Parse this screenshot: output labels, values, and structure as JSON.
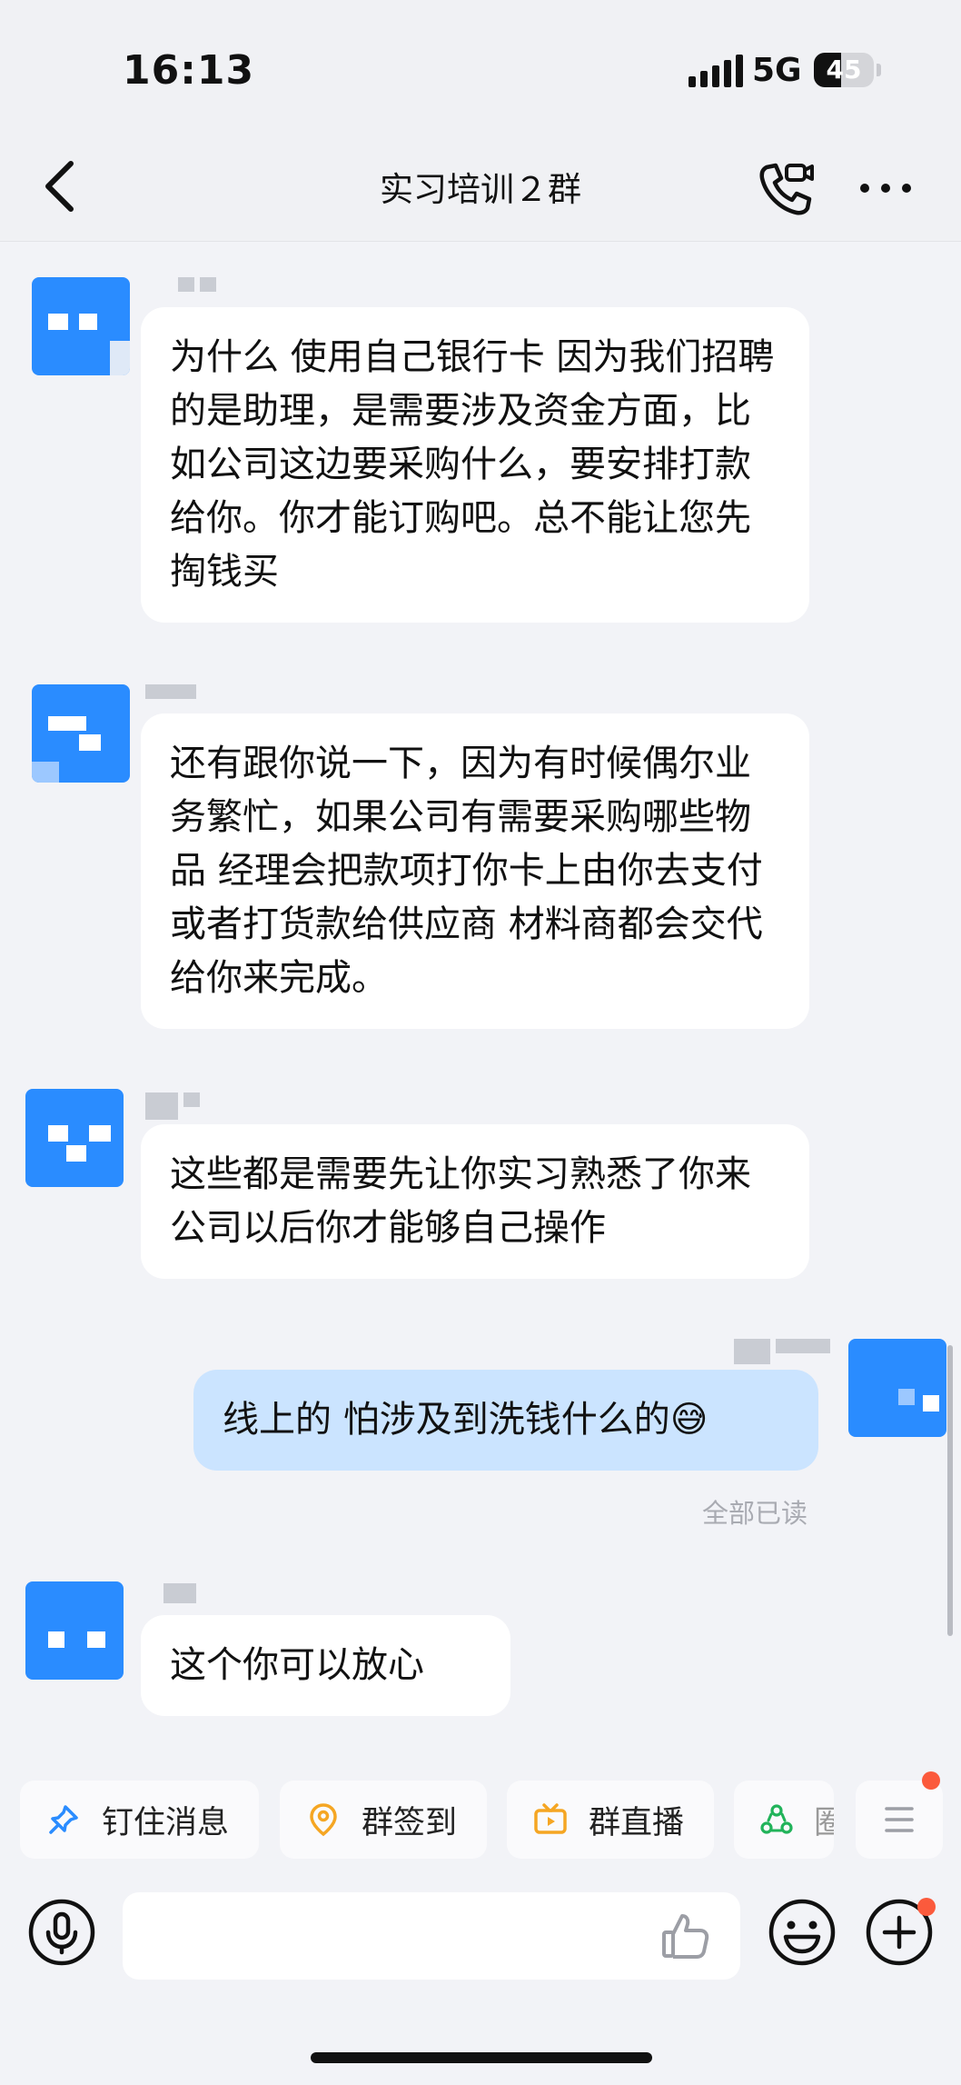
{
  "status_bar": {
    "time": "16:13",
    "network": "5G",
    "battery_level": "45",
    "battery_percent": 45
  },
  "header": {
    "title": "实习培训２群"
  },
  "messages": [
    {
      "text": "为什么 使用自己银行卡 因为我们招聘的是助理，是需要涉及资金方面，比如公司这边要采购什么，要安排打款给你。你才能订购吧。总不能让您先掏钱买"
    },
    {
      "text": "还有跟你说一下，因为有时候偶尔业务繁忙，如果公司有需要采购哪些物品 经理会把款项打你卡上由你去支付  或者打货款给供应商 材料商都会交代给你来完成。"
    },
    {
      "text": "这些都是需要先让你实习熟悉了你来公司以后你才能够自己操作"
    },
    {
      "text": "线上的  怕涉及到洗钱什么的😅"
    },
    {
      "text": "这个你可以放心"
    }
  ],
  "read_receipt": "全部已读",
  "toolbar": {
    "pin": "钉住消息",
    "checkin": "群签到",
    "live": "群直播",
    "circle": "圈"
  },
  "colors": {
    "avatar": "#2a8cff",
    "my_bubble": "#cbe4ff",
    "accent_pin": "#2a8cff",
    "accent_orange": "#f5a623",
    "accent_green": "#21b35a",
    "notice_dot": "#fb5a3c"
  },
  "icons": [
    "back-icon",
    "video-call-icon",
    "more-icon",
    "pin-icon",
    "location-icon",
    "tv-icon",
    "recycle-icon",
    "menu-icon",
    "microphone-icon",
    "thumbs-up-icon",
    "emoji-icon",
    "plus-icon"
  ]
}
